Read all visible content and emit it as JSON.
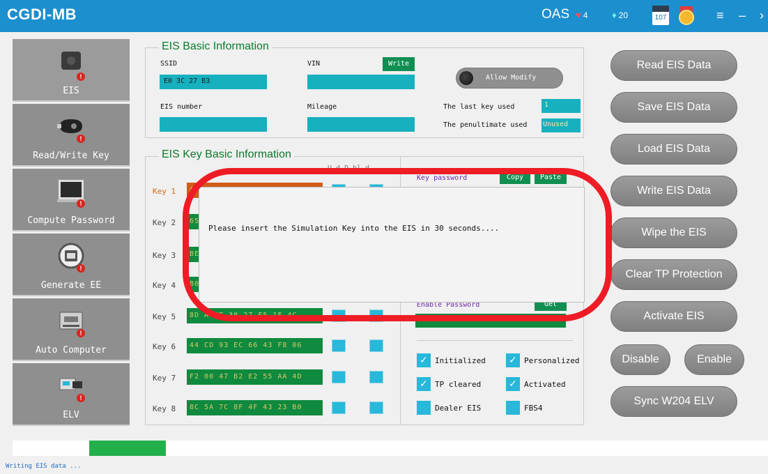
{
  "app": {
    "title": "CGDI-MB"
  },
  "titlebar": {
    "account": "OAS",
    "hearts": "4",
    "gems": "20",
    "calendar": "107",
    "menu_glyph": "≡",
    "minimize_glyph": "–",
    "close_glyph": "›"
  },
  "sidebar": {
    "items": [
      {
        "label": "EIS",
        "icon": "eis-module-icon"
      },
      {
        "label": "Read/Write Key",
        "icon": "car-key-icon"
      },
      {
        "label": "Compute Password",
        "icon": "laptop-icon"
      },
      {
        "label": "Generate EE",
        "icon": "chip-icon"
      },
      {
        "label": "Auto Computer",
        "icon": "ecu-icon"
      },
      {
        "label": "ELV",
        "icon": "elv-module-icon"
      }
    ]
  },
  "eis_basic": {
    "title": "EIS Basic Information",
    "ssid_label": "SSID",
    "ssid_value": "E0 3C 27 B3",
    "vin_label": "VIN",
    "vin_value": "",
    "write_label": "Write",
    "eis_number_label": "EIS number",
    "eis_number_value": "",
    "mileage_label": "Mileage",
    "mileage_value": "",
    "allow_modify_label": "Allow Modify",
    "last_key_label": "The last key used",
    "last_key_value": "1",
    "penultimate_label": "The penultimate used",
    "penultimate_value": "Unused"
  },
  "eis_key": {
    "title": "EIS Key Basic Information",
    "col_header_partial": "U   d  D  bl d",
    "keys": [
      {
        "label": "Key 1",
        "value": "A"
      },
      {
        "label": "Key 2",
        "value": "65"
      },
      {
        "label": "Key 3",
        "value": "BE"
      },
      {
        "label": "Key 4",
        "value": "B0"
      },
      {
        "label": "Key 5",
        "value": "8D  A  FF  30  27  F5  1F  4C"
      },
      {
        "label": "Key 6",
        "value": "44  CD  93  EC  66  43  F8  06"
      },
      {
        "label": "Key 7",
        "value": "F2  00  47  B2  E2  55  AA  4D"
      },
      {
        "label": "Key 8",
        "value": "8C  5A  7C  8F  4F  43  23  B0"
      }
    ],
    "key_password_label": "Key password",
    "copy_label": "Copy",
    "paste_label": "Paste",
    "enable_password_label": "Enable Password",
    "get_label": "Get"
  },
  "status_flags": [
    {
      "label": "Initialized",
      "checked": true
    },
    {
      "label": "Personalized",
      "checked": true
    },
    {
      "label": "TP cleared",
      "checked": true
    },
    {
      "label": "Activated",
      "checked": true
    },
    {
      "label": "Dealer EIS",
      "checked": false
    },
    {
      "label": "FBS4",
      "checked": false
    }
  ],
  "actions": {
    "read": "Read  EIS Data",
    "save": "Save EIS Data",
    "load": "Load EIS Data",
    "write": "Write EIS Data",
    "wipe": "Wipe the EIS",
    "clear_tp": "Clear TP Protection",
    "activate": "Activate EIS",
    "disable": "Disable",
    "enable": "Enable",
    "sync": "Sync W204 ELV"
  },
  "dialog": {
    "message": "Please insert the Simulation Key into the EIS in 30 seconds...."
  },
  "progress": {
    "value": 0.1
  },
  "status": {
    "text": "Writing EIS data ..."
  },
  "colors": {
    "titlebar": "#1c8fcf",
    "field": "#17b0bf",
    "key": "#0f8a3e",
    "annotation": "#ee1c24"
  }
}
